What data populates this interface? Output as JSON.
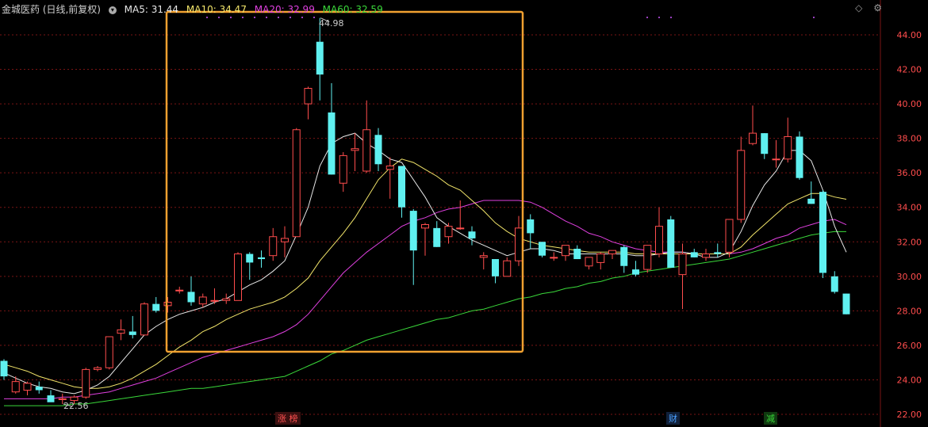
{
  "header": {
    "title": "金城医药 (日线,前复权)",
    "ma5": "MA5: 31.44",
    "ma10": "MA10: 34.47",
    "ma20": "MA20: 32.99",
    "ma60": "MA60: 32.59"
  },
  "toolbar": {
    "diamond_icon": "◇",
    "gear_icon": "⚙"
  },
  "annotations": {
    "high": "44.98",
    "low": "22.56"
  },
  "events": [
    {
      "label": "涨 榜",
      "color": "#ff5050"
    },
    {
      "label": "财",
      "color": "#4aa0ff"
    },
    {
      "label": "减",
      "color": "#3ad83a"
    }
  ],
  "colors": {
    "up": "#ff4d4d",
    "down": "#5ff0f0",
    "ma5": "#e8e8e8",
    "ma10": "#f2e56a",
    "ma20": "#e040e0",
    "ma60": "#3ad83a",
    "grid": "#7a1414",
    "axis": "#ff4d4d",
    "highlight": "#f0a030"
  },
  "chart_data": {
    "type": "candlestick",
    "y_ticks": [
      "44.00",
      "42.00",
      "40.00",
      "38.00",
      "36.00",
      "34.00",
      "32.00",
      "30.00",
      "28.00",
      "26.00",
      "24.00",
      "22.00"
    ],
    "ylim": [
      22,
      45
    ],
    "candles": [
      [
        25.1,
        25.2,
        24.0,
        24.2
      ],
      [
        23.3,
        24.2,
        23.2,
        23.9
      ],
      [
        23.4,
        23.9,
        23.1,
        23.8
      ],
      [
        23.6,
        23.9,
        23.2,
        23.4
      ],
      [
        23.1,
        23.4,
        22.8,
        22.7
      ],
      [
        22.9,
        23.2,
        22.6,
        22.9
      ],
      [
        22.8,
        23.1,
        22.6,
        23.0
      ],
      [
        23.0,
        24.7,
        22.9,
        24.6
      ],
      [
        24.6,
        24.8,
        24.5,
        24.7
      ],
      [
        24.7,
        26.5,
        24.6,
        26.5
      ],
      [
        26.7,
        27.5,
        26.3,
        26.9
      ],
      [
        26.8,
        27.7,
        26.4,
        26.6
      ],
      [
        26.6,
        28.5,
        26.6,
        28.4
      ],
      [
        28.4,
        28.8,
        27.9,
        28.0
      ],
      [
        28.3,
        28.8,
        27.9,
        28.5
      ],
      [
        29.2,
        29.4,
        29.0,
        29.2
      ],
      [
        29.1,
        30.0,
        28.3,
        28.5
      ],
      [
        28.4,
        29.0,
        28.2,
        28.8
      ],
      [
        28.6,
        29.3,
        28.4,
        28.6
      ],
      [
        28.6,
        29.0,
        28.4,
        28.7
      ],
      [
        28.6,
        31.4,
        28.6,
        31.3
      ],
      [
        31.3,
        31.4,
        29.8,
        30.8
      ],
      [
        31.1,
        31.5,
        30.5,
        31.0
      ],
      [
        31.2,
        32.8,
        30.9,
        32.3
      ],
      [
        32.0,
        32.9,
        31.1,
        32.2
      ],
      [
        32.3,
        38.6,
        32.3,
        38.5
      ],
      [
        40.0,
        41.0,
        39.1,
        40.9
      ],
      [
        43.6,
        44.98,
        40.2,
        41.7
      ],
      [
        39.5,
        41.2,
        35.9,
        35.9
      ],
      [
        35.4,
        37.2,
        34.9,
        37.0
      ],
      [
        37.3,
        38.3,
        36.1,
        37.4
      ],
      [
        36.1,
        40.2,
        36.0,
        38.5
      ],
      [
        38.2,
        38.6,
        36.1,
        36.5
      ],
      [
        36.2,
        36.9,
        34.5,
        36.4
      ],
      [
        36.4,
        36.4,
        33.4,
        34.0
      ],
      [
        33.8,
        33.9,
        29.5,
        31.5
      ],
      [
        32.8,
        33.1,
        31.2,
        33.0
      ],
      [
        32.8,
        33.2,
        31.7,
        31.7
      ],
      [
        32.3,
        33.1,
        31.9,
        32.9
      ],
      [
        32.8,
        34.4,
        32.7,
        32.8
      ],
      [
        32.6,
        32.9,
        31.8,
        32.2
      ],
      [
        31.1,
        31.4,
        30.4,
        31.2
      ],
      [
        31.0,
        31.0,
        29.6,
        30.0
      ],
      [
        30.0,
        31.1,
        30.0,
        30.9
      ],
      [
        30.9,
        33.5,
        30.6,
        32.8
      ],
      [
        33.3,
        33.6,
        31.6,
        32.5
      ],
      [
        32.0,
        32.0,
        31.1,
        31.2
      ],
      [
        31.1,
        31.4,
        30.9,
        31.1
      ],
      [
        31.2,
        31.5,
        30.9,
        31.8
      ],
      [
        31.6,
        31.8,
        31.0,
        31.0
      ],
      [
        30.6,
        31.0,
        30.4,
        31.1
      ],
      [
        30.8,
        31.4,
        30.4,
        31.3
      ],
      [
        31.3,
        31.5,
        31.0,
        31.5
      ],
      [
        31.7,
        31.8,
        30.2,
        30.6
      ],
      [
        30.4,
        30.9,
        30.0,
        30.1
      ],
      [
        30.4,
        31.8,
        30.2,
        31.8
      ],
      [
        31.3,
        34.0,
        31.1,
        32.9
      ],
      [
        33.3,
        33.5,
        30.5,
        30.5
      ],
      [
        30.1,
        31.9,
        28.1,
        31.3
      ],
      [
        31.4,
        31.6,
        31.1,
        31.1
      ],
      [
        31.1,
        31.6,
        30.9,
        31.3
      ],
      [
        31.4,
        31.9,
        31.1,
        31.3
      ],
      [
        31.4,
        33.3,
        31.1,
        33.3
      ],
      [
        33.3,
        38.1,
        33.1,
        37.3
      ],
      [
        37.7,
        39.9,
        37.6,
        38.3
      ],
      [
        38.3,
        38.3,
        36.8,
        37.1
      ],
      [
        36.8,
        37.9,
        36.3,
        36.8
      ],
      [
        36.8,
        39.2,
        36.6,
        38.1
      ],
      [
        38.1,
        38.4,
        35.6,
        35.7
      ],
      [
        34.5,
        35.5,
        34.2,
        34.2
      ],
      [
        34.9,
        35.0,
        29.9,
        30.2
      ],
      [
        30.0,
        30.3,
        29.0,
        29.1
      ],
      [
        29.0,
        29.0,
        27.8,
        27.8
      ]
    ],
    "ma5": [
      24.4,
      24.1,
      23.8,
      23.6,
      23.5,
      23.3,
      23.2,
      23.4,
      23.7,
      24.2,
      25.0,
      25.8,
      26.6,
      27.1,
      27.5,
      27.8,
      28.0,
      28.2,
      28.5,
      28.7,
      29.1,
      29.5,
      29.8,
      30.3,
      30.9,
      32.4,
      34.0,
      36.4,
      37.7,
      38.1,
      38.3,
      37.7,
      37.3,
      36.8,
      36.6,
      35.6,
      34.6,
      33.4,
      32.9,
      32.5,
      32.1,
      31.8,
      31.5,
      31.2,
      31.4,
      31.6,
      31.6,
      31.5,
      31.3,
      31.3,
      31.3,
      31.3,
      31.3,
      31.3,
      31.2,
      31.2,
      31.3,
      31.4,
      31.4,
      31.3,
      31.1,
      31.1,
      31.4,
      32.6,
      34.1,
      35.3,
      36.1,
      37.3,
      37.3,
      36.7,
      35.0,
      32.9,
      31.4
    ],
    "ma10": [
      24.9,
      24.7,
      24.5,
      24.2,
      24.0,
      23.8,
      23.6,
      23.5,
      23.5,
      23.6,
      23.8,
      24.1,
      24.5,
      24.9,
      25.4,
      25.9,
      26.3,
      26.8,
      27.1,
      27.5,
      27.8,
      28.1,
      28.3,
      28.5,
      28.8,
      29.3,
      29.9,
      30.9,
      31.7,
      32.5,
      33.4,
      34.5,
      35.6,
      36.3,
      36.8,
      36.6,
      36.2,
      35.8,
      35.3,
      35.0,
      34.4,
      33.8,
      33.1,
      32.6,
      32.2,
      32.0,
      31.8,
      31.7,
      31.6,
      31.5,
      31.4,
      31.4,
      31.4,
      31.4,
      31.3,
      31.3,
      31.3,
      31.3,
      31.3,
      31.3,
      31.3,
      31.3,
      31.3,
      31.7,
      32.4,
      33.0,
      33.6,
      34.2,
      34.5,
      34.8,
      34.8,
      34.6,
      34.47
    ],
    "ma20": [
      22.9,
      22.9,
      22.9,
      22.9,
      22.9,
      23.0,
      23.0,
      23.1,
      23.2,
      23.3,
      23.5,
      23.7,
      23.9,
      24.1,
      24.4,
      24.7,
      25.0,
      25.3,
      25.5,
      25.7,
      25.9,
      26.1,
      26.3,
      26.5,
      26.8,
      27.2,
      27.8,
      28.6,
      29.4,
      30.2,
      30.8,
      31.4,
      31.9,
      32.4,
      32.9,
      33.2,
      33.4,
      33.7,
      33.9,
      34.0,
      34.2,
      34.4,
      34.4,
      34.4,
      34.4,
      34.3,
      34.0,
      33.6,
      33.2,
      32.9,
      32.5,
      32.3,
      32.0,
      31.8,
      31.6,
      31.5,
      31.4,
      31.4,
      31.4,
      31.3,
      31.3,
      31.3,
      31.3,
      31.4,
      31.6,
      31.9,
      32.2,
      32.4,
      32.8,
      33.0,
      33.2,
      33.3,
      32.99
    ],
    "ma60": [
      22.5,
      22.5,
      22.5,
      22.5,
      22.5,
      22.5,
      22.6,
      22.6,
      22.7,
      22.8,
      22.9,
      23.0,
      23.1,
      23.2,
      23.3,
      23.4,
      23.5,
      23.5,
      23.6,
      23.7,
      23.8,
      23.9,
      24.0,
      24.1,
      24.2,
      24.5,
      24.8,
      25.1,
      25.5,
      25.7,
      26.0,
      26.3,
      26.5,
      26.7,
      26.9,
      27.1,
      27.3,
      27.5,
      27.6,
      27.8,
      28.0,
      28.1,
      28.3,
      28.5,
      28.7,
      28.8,
      29.0,
      29.1,
      29.3,
      29.4,
      29.6,
      29.7,
      29.9,
      30.0,
      30.2,
      30.3,
      30.4,
      30.5,
      30.6,
      30.7,
      30.8,
      30.9,
      31.0,
      31.2,
      31.4,
      31.6,
      31.8,
      32.0,
      32.2,
      32.4,
      32.5,
      32.6,
      32.59
    ]
  }
}
